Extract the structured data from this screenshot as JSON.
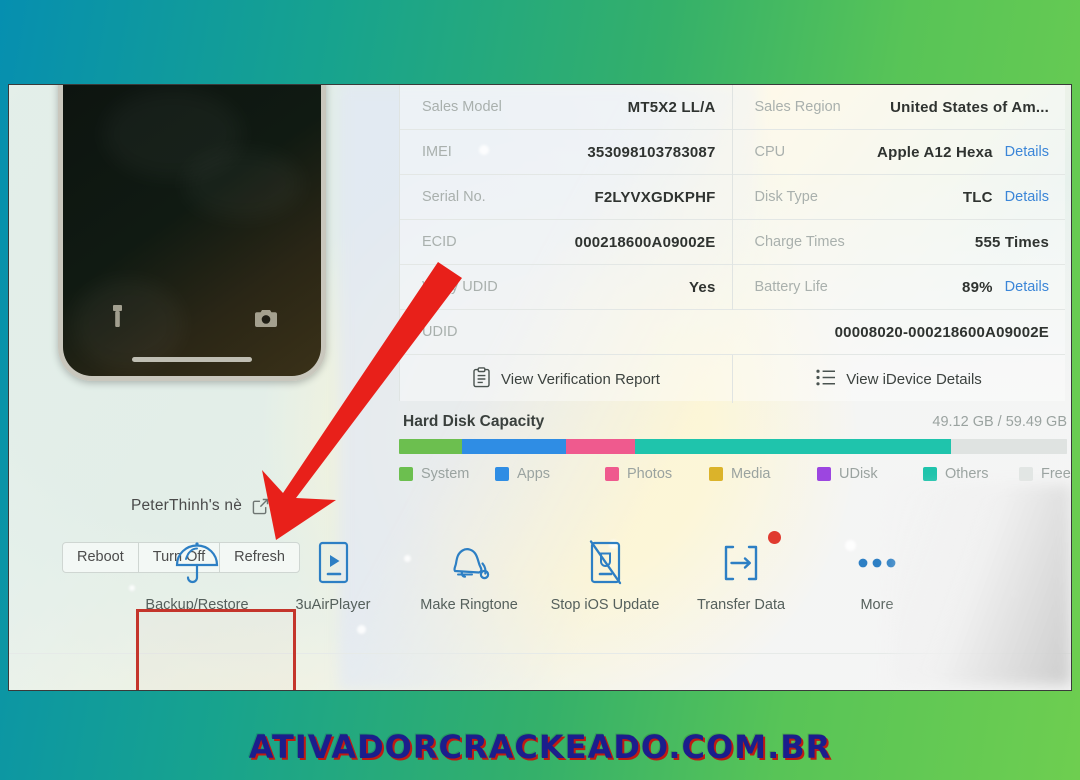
{
  "background": {
    "gradient_from": "#068fb0",
    "gradient_to": "#6ece50"
  },
  "device_panel": {
    "device_name": "PeterThinh's nè",
    "edit_icon": "edit-square-icon",
    "phone_screen": {
      "flashlight_icon": "flashlight-icon",
      "camera_icon": "camera-icon"
    },
    "buttons": [
      {
        "label": "Reboot",
        "name": "reboot"
      },
      {
        "label": "Turn Off",
        "name": "turn-off"
      },
      {
        "label": "Refresh",
        "name": "refresh"
      }
    ]
  },
  "info_card": {
    "left_rows": [
      {
        "label": "Sales Model",
        "value": "MT5X2 LL/A"
      },
      {
        "label": "IMEI",
        "value": "353098103783087"
      },
      {
        "label": "Serial No.",
        "value": "F2LYVXGDKPHF"
      },
      {
        "label": "ECID",
        "value": "000218600A09002E"
      },
      {
        "label": "Verify UDID",
        "value": "Yes"
      }
    ],
    "right_rows": [
      {
        "label": "Sales Region",
        "value": "United States of Am...",
        "details": ""
      },
      {
        "label": "CPU",
        "value": "Apple A12 Hexa",
        "details": "Details"
      },
      {
        "label": "Disk Type",
        "value": "TLC",
        "details": "Details"
      },
      {
        "label": "Charge Times",
        "value": "555 Times",
        "details": ""
      },
      {
        "label": "Battery Life",
        "value": "89%",
        "details": "Details"
      }
    ],
    "udid": {
      "label": "UDID",
      "value": "00008020-000218600A09002E"
    },
    "actions": [
      {
        "label": "View Verification Report",
        "icon": "clipboard-icon",
        "name": "view-verification-report"
      },
      {
        "label": "View iDevice Details",
        "icon": "list-icon",
        "name": "view-idevice-details"
      }
    ]
  },
  "capacity": {
    "title": "Hard Disk Capacity",
    "size_text": "49.12 GB / 59.49 GB",
    "used_gb": 49.12,
    "total_gb": 59.49,
    "segments": [
      {
        "label": "System",
        "color": "#6cbf4f",
        "percent": 9.4
      },
      {
        "label": "Apps",
        "color": "#2f8de4",
        "percent": 15.6
      },
      {
        "label": "Photos",
        "color": "#ef5a8e",
        "percent": 10.3
      },
      {
        "label": "Media",
        "color": "#dbb32a",
        "percent": 0
      },
      {
        "label": "UDisk",
        "color": "#9c46e0",
        "percent": 0
      },
      {
        "label": "Others",
        "color": "#1fc4ac",
        "percent": 47.3
      },
      {
        "label": "Free",
        "color": "#dfe3e1",
        "percent": 17.4
      }
    ]
  },
  "toolbar": {
    "items": [
      {
        "label": "Backup/Restore",
        "icon": "umbrella-icon",
        "name": "backup-restore",
        "highlighted": true,
        "badge": false
      },
      {
        "label": "3uAirPlayer",
        "icon": "airplay-phone-icon",
        "name": "3u-airplayer",
        "highlighted": false,
        "badge": false
      },
      {
        "label": "Make Ringtone",
        "icon": "bell-icon",
        "name": "make-ringtone",
        "highlighted": false,
        "badge": false
      },
      {
        "label": "Stop iOS Update",
        "icon": "phone-block-icon",
        "name": "stop-ios-update",
        "highlighted": false,
        "badge": false
      },
      {
        "label": "Transfer Data",
        "icon": "transfer-arrow-icon",
        "name": "transfer-data",
        "highlighted": false,
        "badge": true
      },
      {
        "label": "More",
        "icon": "ellipsis-icon",
        "name": "more",
        "highlighted": false,
        "badge": false
      }
    ]
  },
  "annotation": {
    "arrow_color": "#e8201a",
    "highlight_color": "#c4352b",
    "target": "Backup/Restore"
  },
  "watermark": {
    "text": "ATIVADORCRACKEADO.COM.BR",
    "color": "#1b1e8c",
    "shadow_color": "#c01a12"
  }
}
